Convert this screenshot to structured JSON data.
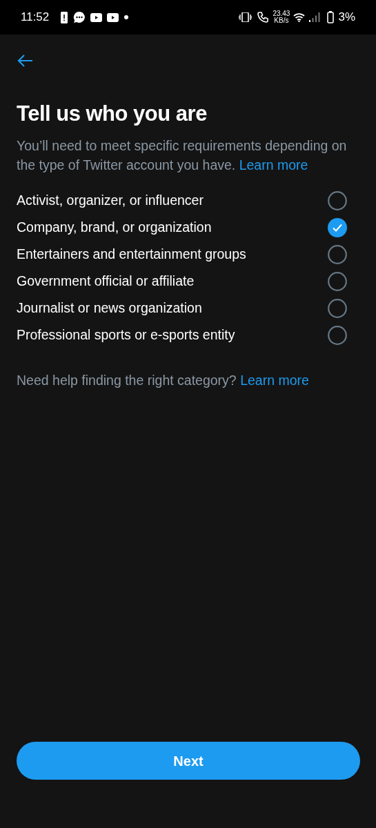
{
  "status_bar": {
    "time": "11:52",
    "speed_value": "23.43",
    "speed_unit": "KB/s",
    "battery": "3%"
  },
  "title": "Tell us who you are",
  "intro": {
    "text": "You’ll need to meet specific requirements depending on the type of Twitter account you have.",
    "link": "Learn more"
  },
  "options": [
    {
      "label": "Activist, organizer, or influencer",
      "selected": false
    },
    {
      "label": "Company, brand, or organization",
      "selected": true
    },
    {
      "label": "Entertainers and entertainment groups",
      "selected": false
    },
    {
      "label": "Government official or affiliate",
      "selected": false
    },
    {
      "label": "Journalist or news organization",
      "selected": false
    },
    {
      "label": "Professional sports or e-sports entity",
      "selected": false
    }
  ],
  "help": {
    "text": "Need help finding the right category?",
    "link": "Learn more"
  },
  "next_button": "Next"
}
